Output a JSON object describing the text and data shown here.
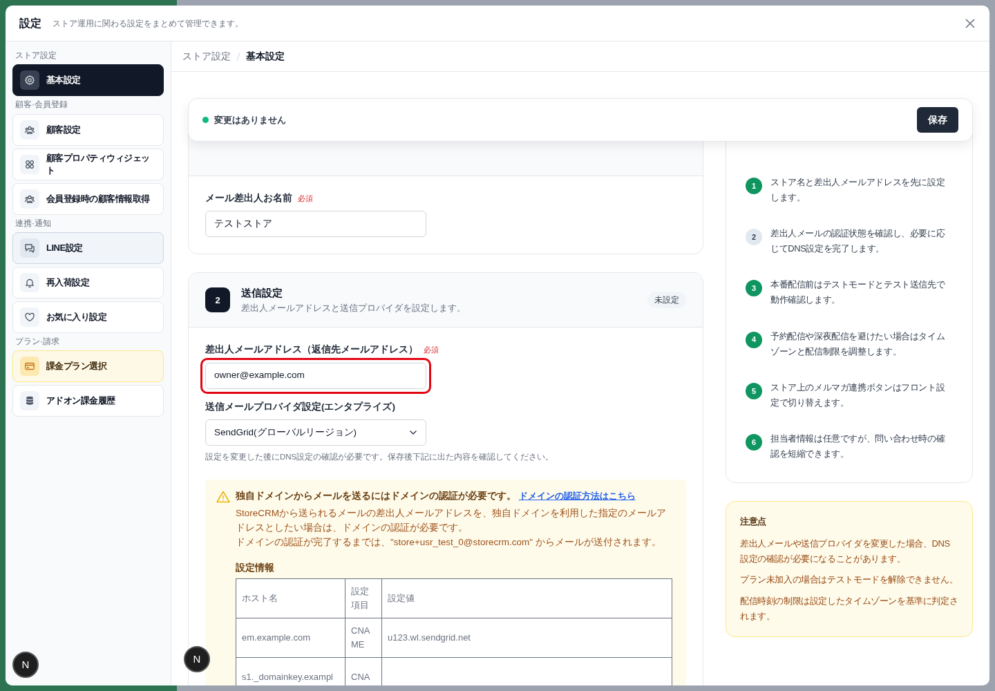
{
  "modal": {
    "title": "設定",
    "subtitle": "ストア運用に関わる設定をまとめて管理できます。"
  },
  "sidebar": {
    "groups": [
      {
        "label": "ストア設定",
        "items": [
          {
            "label": "基本設定",
            "selected": true,
            "hovered": false,
            "highlighted": false
          }
        ]
      },
      {
        "label": "顧客·会員登録",
        "items": [
          {
            "label": "顧客設定",
            "selected": false,
            "hovered": false,
            "highlighted": false
          },
          {
            "label": "顧客プロパティウィジェット",
            "selected": false,
            "hovered": false,
            "highlighted": false
          },
          {
            "label": "会員登録時の顧客情報取得",
            "selected": false,
            "hovered": false,
            "highlighted": false
          }
        ]
      },
      {
        "label": "連携·通知",
        "items": [
          {
            "label": "LINE設定",
            "selected": false,
            "hovered": true,
            "highlighted": false
          },
          {
            "label": "再入荷設定",
            "selected": false,
            "hovered": false,
            "highlighted": false
          },
          {
            "label": "お気に入り設定",
            "selected": false,
            "hovered": false,
            "highlighted": false
          }
        ]
      },
      {
        "label": "プラン·請求",
        "items": [
          {
            "label": "課金プラン選択",
            "selected": false,
            "hovered": false,
            "highlighted": true
          },
          {
            "label": "アドオン課金履歴",
            "selected": false,
            "hovered": false,
            "highlighted": false
          }
        ]
      }
    ]
  },
  "breadcrumb": [
    {
      "label": "ストア設定",
      "current": false
    },
    {
      "label": "基本設定",
      "current": true
    }
  ],
  "save_bar": {
    "status": "変更はありません",
    "button": "保存"
  },
  "sender_name": {
    "label": "メール差出人お名前",
    "required": "必須",
    "value": "テストストア"
  },
  "sending": {
    "number": "2",
    "title": "送信設定",
    "description": "差出人メールアドレスと送信プロバイダを設定します。",
    "status": "未設定",
    "email_field": {
      "label": "差出人メールアドレス（返信先メールアドレス）",
      "required": "必須",
      "value": "owner@example.com",
      "highlighted": true
    },
    "provider_field": {
      "label": "送信メールプロバイダ設定(エンタプライズ)",
      "value": "SendGrid(グローバルリージョン)"
    },
    "help": "設定を変更した後にDNS設定の確認が必要です。保存後下記に出た内容を確認してください。",
    "alert": {
      "title": "独自ドメインからメールを送るにはドメインの認証が必要です。",
      "link": "ドメインの認証方法はこちら",
      "paragraphs": [
        "StoreCRMから送られるメールの差出人メールアドレスを、独自ドメインを利用した指定のメールアドレスとしたい場合は、ドメインの認証が必要です。",
        "ドメインの認証が完了するまでは、\"store+usr_test_0@storecrm.com\" からメールが送付されます。"
      ]
    },
    "table": {
      "title": "設定情報",
      "columns": [
        "ホスト名",
        "設定項目",
        "設定値"
      ],
      "rows": [
        [
          "em.example.com",
          "CNAME",
          "u123.wl.sendgrid.net"
        ],
        [
          "s1._domainkey.exampl",
          "CNA"
        ]
      ]
    }
  },
  "steps": [
    {
      "number": "1",
      "text": "ストア名と差出人メールアドレスを先に設定します。",
      "done": true
    },
    {
      "number": "2",
      "text": "差出人メールの認証状態を確認し、必要に応じてDNS設定を完了します。",
      "done": false
    },
    {
      "number": "3",
      "text": "本番配信前はテストモードとテスト送信先で動作確認します。",
      "done": true
    },
    {
      "number": "4",
      "text": "予約配信や深夜配信を避けたい場合はタイムゾーンと配信制限を調整します。",
      "done": true
    },
    {
      "number": "5",
      "text": "ストア上のメルマガ連携ボタンはフロント設定で切り替えます。",
      "done": true
    },
    {
      "number": "6",
      "text": "担当者情報は任意ですが、問い合わせ時の確認を短縮できます。",
      "done": true
    }
  ],
  "notes": {
    "title": "注意点",
    "items": [
      "差出人メールや送信プロバイダを変更した場合、DNS設定の確認が必要になることがあります。",
      "プラン未加入の場合はテストモードを解除できません。",
      "配信時刻の制限は設定したタイムゾーンを基準に判定されます。"
    ]
  },
  "dev_badges": [
    "N",
    "N"
  ]
}
